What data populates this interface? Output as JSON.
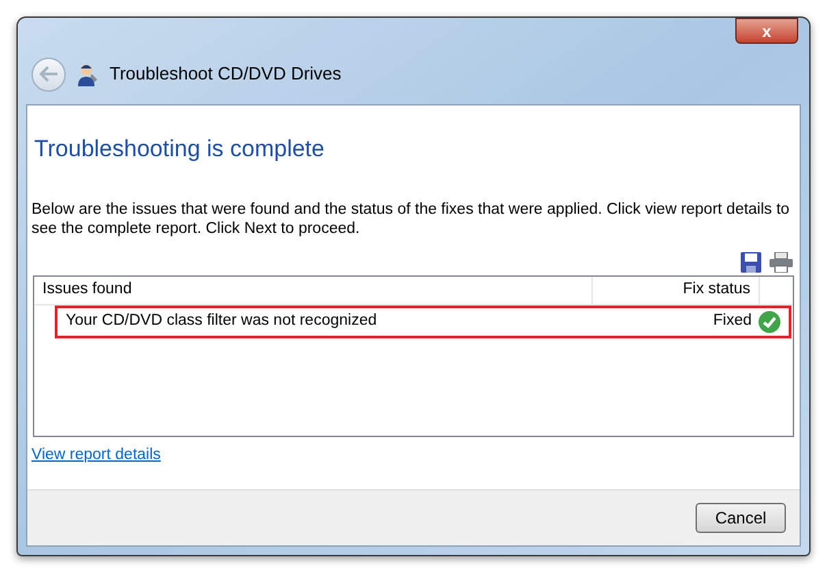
{
  "window": {
    "title": "Troubleshoot CD/DVD Drives",
    "close_label": "x"
  },
  "heading": "Troubleshooting is complete",
  "description": "Below are the issues that were found and the status of the fixes that were applied. Click view report details to see the complete report. Click Next to proceed.",
  "table": {
    "columns": [
      "Issues found",
      "Fix status"
    ],
    "rows": [
      {
        "issue": "Your CD/DVD class filter was not recognized",
        "status": "Fixed",
        "fixed": true,
        "highlighted": true
      }
    ]
  },
  "link": "View report details",
  "buttons": [
    "Cancel"
  ]
}
